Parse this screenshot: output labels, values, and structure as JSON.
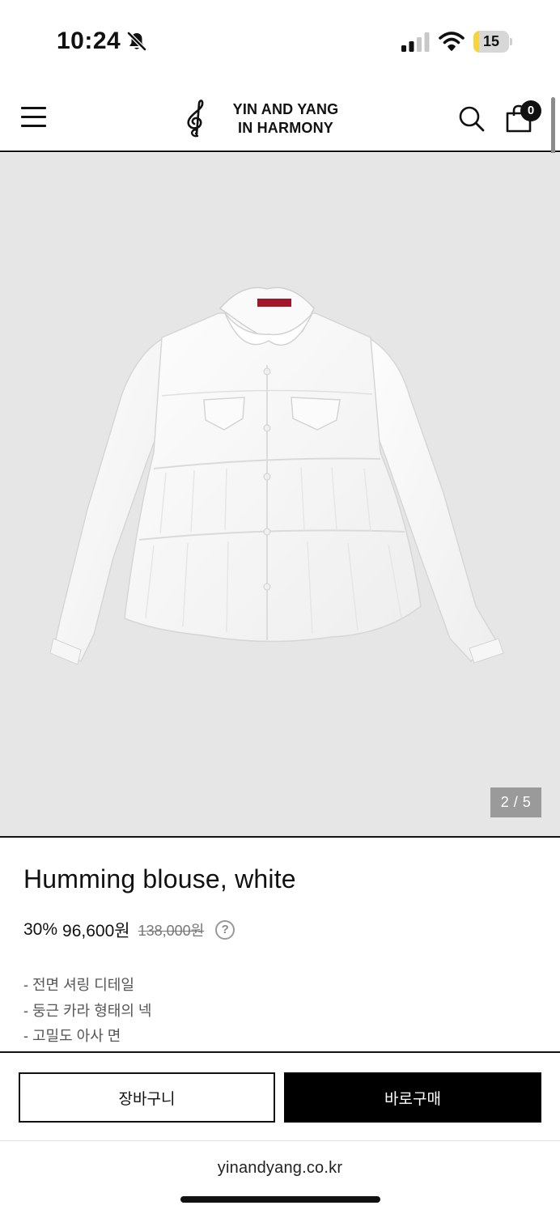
{
  "status_bar": {
    "time": "10:24",
    "battery_level": "15",
    "battery_fraction": 0.15,
    "signal_bars_active": 2,
    "icons": [
      "bell-slash-icon",
      "signal-icon",
      "wifi-icon",
      "battery-icon"
    ]
  },
  "header": {
    "brand_line1": "YIN AND YANG",
    "brand_line2": "IN HARMONY",
    "cart_count": "0",
    "icons": [
      "menu-icon",
      "treble-clef-icon",
      "search-icon",
      "shopping-bag-icon"
    ]
  },
  "gallery": {
    "counter": "2 / 5",
    "current_index": 2,
    "total": 5
  },
  "product": {
    "title": "Humming blouse, white",
    "discount": "30%",
    "sale_price": "96,600원",
    "original_price": "138,000원",
    "help_symbol": "?",
    "features": [
      "- 전면 셔링 디테일",
      "- 둥근 카라 형태의 넥",
      "- 고밀도 아사 면"
    ]
  },
  "actions": {
    "cart_label": "장바구니",
    "buy_label": "바로구매"
  },
  "browser": {
    "url": "yinandyang.co.kr"
  },
  "colors": {
    "accent": "#000000",
    "image_background": "#e6e6e6",
    "battery_fill": "#f7d43c",
    "counter_background": "#9a9a9a"
  }
}
